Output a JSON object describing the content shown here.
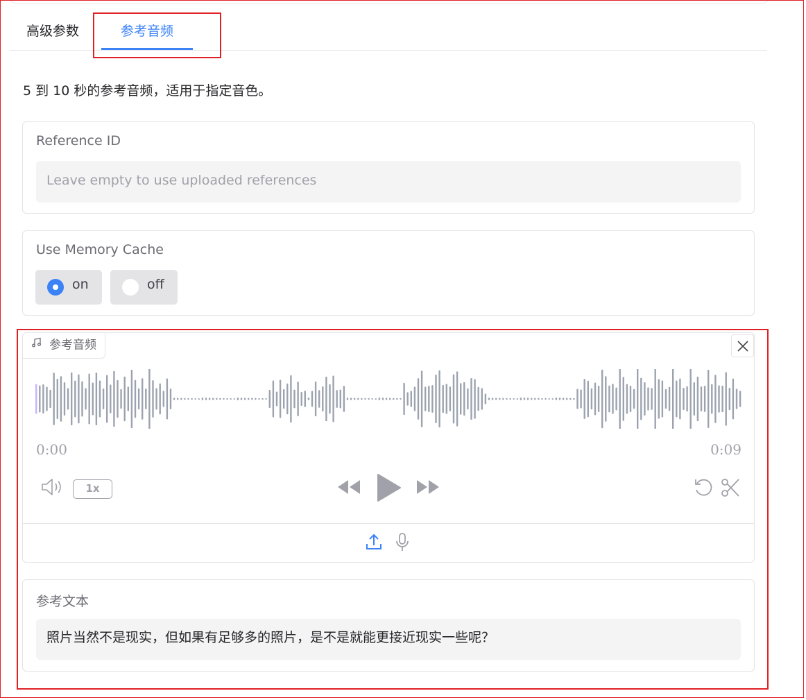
{
  "tabs": [
    {
      "label": "高级参数"
    },
    {
      "label": "参考音频"
    }
  ],
  "description": "5 到 10 秒的参考音频，适用于指定音色。",
  "reference_id": {
    "label": "Reference ID",
    "placeholder": "Leave empty to use uploaded references",
    "value": ""
  },
  "memory_cache": {
    "label": "Use Memory Cache",
    "options": [
      {
        "label": "on",
        "selected": true
      },
      {
        "label": "off",
        "selected": false
      }
    ]
  },
  "audio": {
    "label": "参考音频",
    "current_time": "0:00",
    "duration": "0:09",
    "speed": "1x",
    "icons": [
      "music-note-icon",
      "close-icon",
      "volume-icon",
      "rewind-icon",
      "play-icon",
      "fast-forward-icon",
      "undo-icon",
      "scissors-icon",
      "upload-icon",
      "microphone-icon"
    ]
  },
  "reference_text": {
    "label": "参考文本",
    "value": "照片当然不是现实，但如果有足够多的照片，是不是就能更接近现实一些呢？"
  },
  "colors": {
    "accent": "#3b82f6",
    "highlight_border": "#e02025",
    "waveform": "#9ca3af"
  }
}
